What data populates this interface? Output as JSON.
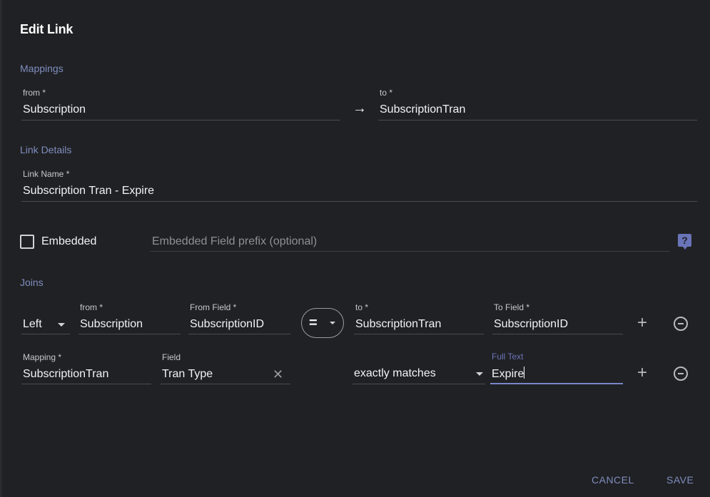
{
  "dialog": {
    "title": "Edit Link"
  },
  "sections": {
    "mappings": "Mappings",
    "link_details": "Link Details",
    "joins": "Joins"
  },
  "mapping": {
    "from_label": "from *",
    "from_value": "Subscription",
    "arrow": "→",
    "to_label": "to *",
    "to_value": "SubscriptionTran"
  },
  "link_details": {
    "name_label": "Link Name *",
    "name_value": "Subscription Tran - Expire"
  },
  "embedded": {
    "label": "Embedded",
    "checked": false,
    "prefix_placeholder": "Embedded Field prefix (optional)",
    "help": "?"
  },
  "join": {
    "type_value": "Left",
    "from_label": "from *",
    "from_value": "Subscription",
    "from_field_label": "From Field *",
    "from_field_value": "SubscriptionID",
    "operator": "=",
    "to_label": "to *",
    "to_value": "SubscriptionTran",
    "to_field_label": "To Field *",
    "to_field_value": "SubscriptionID"
  },
  "condition": {
    "mapping_label": "Mapping *",
    "mapping_value": "SubscriptionTran",
    "field_label": "Field",
    "field_value": "Tran Type",
    "match_value": "exactly matches",
    "text_label": "Full Text",
    "text_value": "Expire"
  },
  "icons": {
    "add": "+",
    "clear": "✕"
  },
  "actions": {
    "cancel": "CANCEL",
    "save": "SAVE"
  },
  "colors": {
    "accent": "#7f8dbf",
    "background": "#202124"
  }
}
